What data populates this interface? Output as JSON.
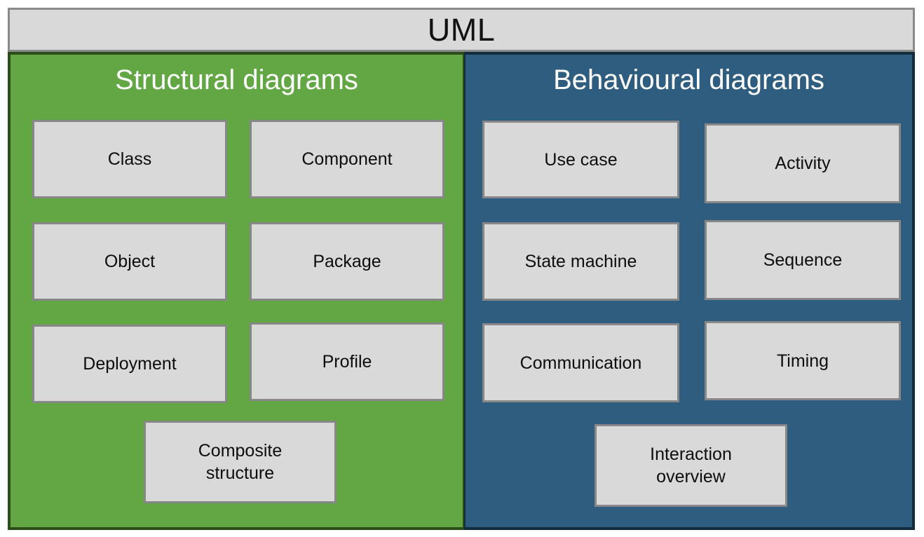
{
  "header": {
    "title": "UML"
  },
  "panels": [
    {
      "id": "structural",
      "title": "Structural diagrams",
      "color": "#62a744",
      "border_color": "#2c4c1a",
      "items": [
        {
          "label": "Class"
        },
        {
          "label": "Component"
        },
        {
          "label": "Object"
        },
        {
          "label": "Package"
        },
        {
          "label": "Deployment"
        },
        {
          "label": "Profile"
        },
        {
          "label": "Composite structure",
          "lines": [
            "Composite",
            "structure"
          ]
        }
      ]
    },
    {
      "id": "behavioural",
      "title": "Behavioural diagrams",
      "color": "#2f5d80",
      "border_color": "#122b3d",
      "items": [
        {
          "label": "Use case"
        },
        {
          "label": "Activity"
        },
        {
          "label": "State machine"
        },
        {
          "label": "Sequence"
        },
        {
          "label": "Communication"
        },
        {
          "label": "Timing"
        },
        {
          "label": "Interaction overview",
          "lines": [
            "Interaction",
            "overview"
          ]
        }
      ]
    }
  ],
  "box_style": {
    "fill": "#d9d9d9",
    "border": "#878787",
    "text": "#0d0d0d"
  }
}
